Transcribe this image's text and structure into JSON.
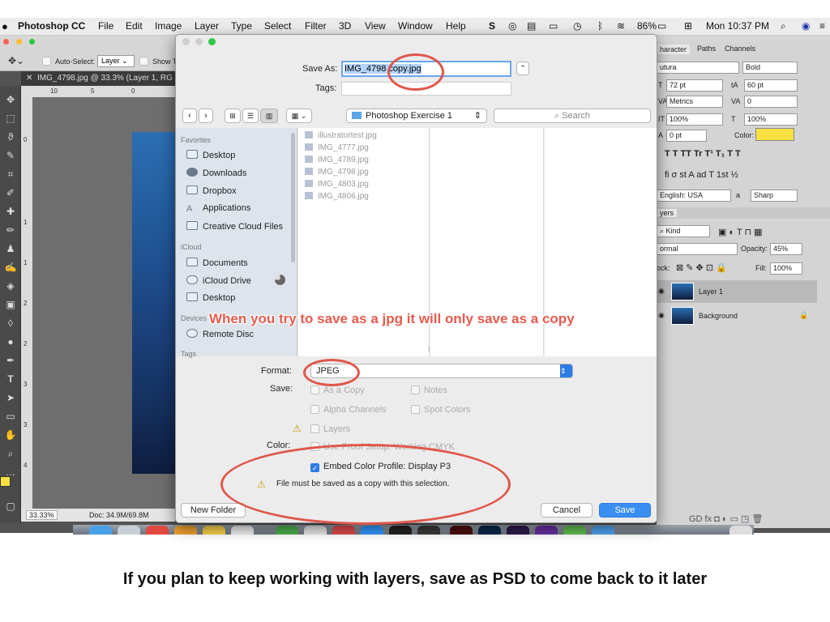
{
  "menubar": {
    "apple": "",
    "app": "Photoshop CC",
    "items": [
      "File",
      "Edit",
      "Image",
      "Layer",
      "Type",
      "Select",
      "Filter",
      "3D",
      "View",
      "Window",
      "Help"
    ],
    "battery": "86%",
    "clock": "Mon 10:37 PM"
  },
  "ps": {
    "options": {
      "auto_select": "Auto-Select:",
      "layer_value": "Layer",
      "show": "Show Tr"
    },
    "doc_tab": "IMG_4798.jpg @ 33.3% (Layer 1, RG",
    "ruler_top": [
      "10",
      "5",
      "0"
    ],
    "ruler_left": [
      "0",
      "1",
      "1",
      "2",
      "2",
      "3",
      "3",
      "4"
    ],
    "status_zoom": "33.33%",
    "status_doc": "Doc: 34.9M/69.8M"
  },
  "panel": {
    "tabs": [
      "haracter",
      "Paths",
      "Channels"
    ],
    "font_family": "utura",
    "font_style": "Bold",
    "size": "72 pt",
    "leading": "60 pt",
    "kerning": "Metrics",
    "tracking": "0",
    "vscale": "100%",
    "hscale": "100%",
    "baseline": "0 pt",
    "color_label": "Color:",
    "text_style_row": "T  T  TT  Tr  T¹  T₁  T  T",
    "opentype_row": "fi  σ  st  A  ad  T  1st  ½",
    "language": "English: USA",
    "aa_label": "a",
    "aa_value": "Sharp",
    "layers_tab": "yers",
    "kind": "Kind",
    "blend": "ormal",
    "opacity_label": "Opacity:",
    "opacity": "45%",
    "lock_label": "ock:",
    "fill_label": "Fill:",
    "fill": "100%",
    "layers": [
      "Layer 1",
      "Background"
    ],
    "bottom_icons": "GD  fx  ◘  ◐  ▭  ◳  🗑"
  },
  "dialog": {
    "save_as_label": "Save As:",
    "save_as_value": "IMG_4798 copy.jpg",
    "tags_label": "Tags:",
    "location": "Photoshop Exercise 1",
    "search_placeholder": "Search",
    "sidebar": {
      "favorites_header": "Favorites",
      "favorites": [
        "Desktop",
        "Downloads",
        "Dropbox",
        "Applications",
        "Creative Cloud Files"
      ],
      "icloud_header": "iCloud",
      "icloud": [
        "Documents",
        "iCloud Drive",
        "Desktop"
      ],
      "devices_header": "Devices",
      "devices": [
        "Remote Disc"
      ],
      "tags_header": "Tags"
    },
    "files": [
      "illustratortest.jpg",
      "IMG_4777.jpg",
      "IMG_4789.jpg",
      "IMG_4798.jpg",
      "IMG_4803.jpg",
      "IMG_4806.jpg"
    ],
    "format_label": "Format:",
    "format_value": "JPEG",
    "save_label": "Save:",
    "opt_as_copy": "As a Copy",
    "opt_notes": "Notes",
    "opt_alpha": "Alpha Channels",
    "opt_spot": "Spot Colors",
    "opt_layers": "Layers",
    "color_label": "Color:",
    "opt_proof": "Use Proof Setup:  Working CMYK",
    "opt_embed": "Embed Color Profile:  Display P3",
    "warning": "File must be saved as a copy with this selection.",
    "new_folder": "New Folder",
    "cancel": "Cancel",
    "save": "Save"
  },
  "annotation": "When you try to save as a jpg it will only save as a copy",
  "caption": "If you plan to keep working with layers, save as PSD to come back to it later",
  "colors": {
    "accent": "#2c7be5",
    "annotation": "#e0574b",
    "swatch_fg": "#f7e042"
  }
}
